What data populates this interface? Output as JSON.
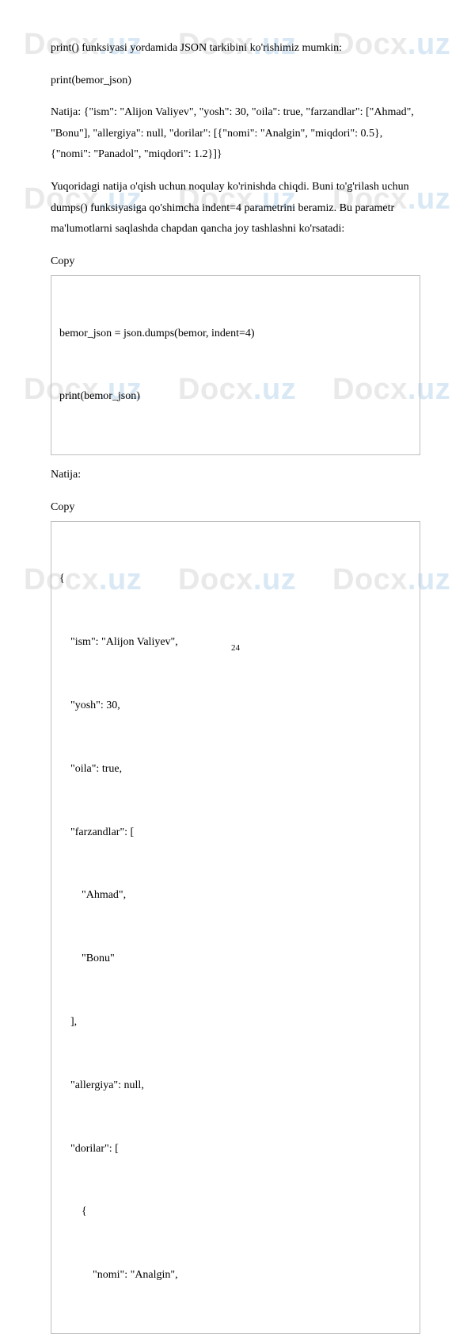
{
  "watermark": {
    "brand_main": "Docx",
    "brand_accent": ".uz"
  },
  "para1": "print() funksiyasi yordamida JSON tarkibini ko'rishimiz mumkin:",
  "para2": "print(bemor_json)",
  "para3": "Natija: {\"ism\": \"Alijon Valiyev\", \"yosh\": 30, \"oila\": true, \"farzandlar\": [\"Ahmad\", \"Bonu\"], \"allergiya\": null, \"dorilar\": [{\"nomi\": \"Analgin\", \"miqdori\": 0.5}, {\"nomi\": \"Panadol\", \"miqdori\": 1.2}]}",
  "para4": "Yuqoridagi natija o'qish uchun noqulay ko'rinishda chiqdi. Buni to'g'rilash uchun dumps() funksiyasiga qo'shimcha indent=4 parametrini beramiz. Bu parametr ma'lumotlarni saqlashda chapdan qancha joy tashlashni ko'rsatadi:",
  "copy_label": "Copy",
  "code1": {
    "l1": "bemor_json = json.dumps(bemor, indent=4)",
    "l2": "print(bemor_json)"
  },
  "para5": "Natija:",
  "code2": {
    "l1": "{",
    "l2": "    \"ism\": \"Alijon Valiyev\",",
    "l3": "    \"yosh\": 30,",
    "l4": "    \"oila\": true,",
    "l5": "    \"farzandlar\": [",
    "l6": "        \"Ahmad\",",
    "l7": "        \"Bonu\"",
    "l8": "    ],",
    "l9": "    \"allergiya\": null,",
    "l10": "    \"dorilar\": [",
    "l11": "        {",
    "l12": "            \"nomi\": \"Analgin\","
  },
  "page_number": "24"
}
